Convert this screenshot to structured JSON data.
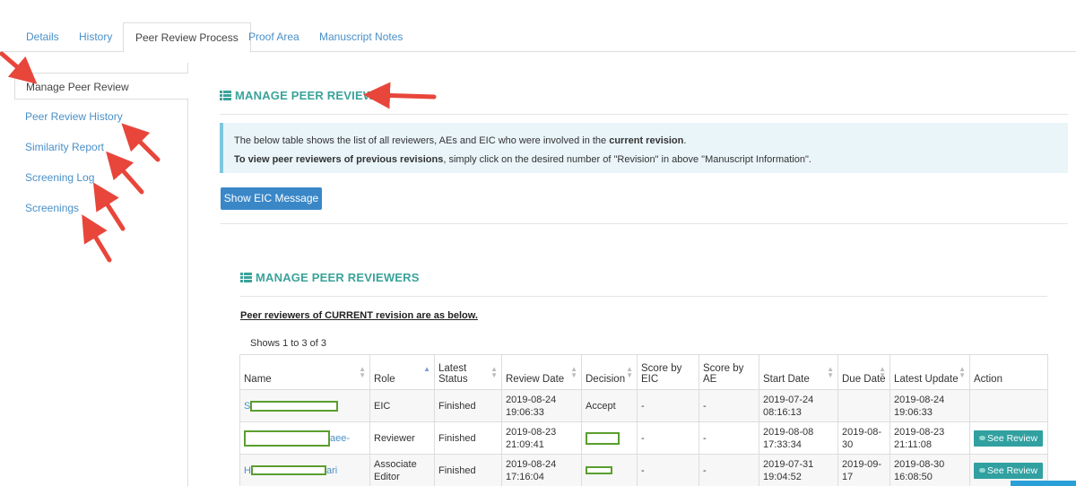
{
  "tabs": [
    "Details",
    "History",
    "Peer Review Process",
    "Proof Area",
    "Manuscript Notes"
  ],
  "active_tab": 2,
  "sidebar": {
    "items": [
      "Manage Peer Review",
      "Peer Review History",
      "Similarity Report",
      "Screening Log",
      "Screenings"
    ]
  },
  "main": {
    "title": "MANAGE PEER REVIEW",
    "info": {
      "line1_prefix": "The below table shows the list of all reviewers, AEs and EIC who were involved in the ",
      "line1_bold": "current revision",
      "line1_suffix": ".",
      "line2_bold": "To view peer reviewers of previous revisions",
      "line2_suffix": ", simply click on the desired number of  \"Revision\" in above \"Manuscript Information\"."
    },
    "show_eic_button": "Show EIC Message"
  },
  "reviewers": {
    "title": "MANAGE PEER REVIEWERS",
    "subtitle": "Peer reviewers of CURRENT revision are as below.",
    "shows": "Shows 1 to 3 of 3",
    "columns": [
      "Name",
      "Role",
      "Latest Status",
      "Review Date",
      "Decision",
      "Score by EIC",
      "Score by AE",
      "Start Date",
      "Due Date",
      "Latest Update",
      "Action"
    ],
    "rows": [
      {
        "name_pre": "S",
        "name_post": "",
        "role": "EIC",
        "status": "Finished",
        "review_date": "2019-08-24 19:06:33",
        "decision": "Accept",
        "score_eic": "-",
        "score_ae": "-",
        "start_date": "2019-07-24 08:16:13",
        "due_date": "",
        "latest_update": "2019-08-24 19:06:33",
        "action": ""
      },
      {
        "name_pre": "",
        "name_post": "aee-",
        "role": "Reviewer",
        "status": "Finished",
        "review_date": "2019-08-23 21:09:41",
        "decision": "",
        "score_eic": "-",
        "score_ae": "-",
        "start_date": "2019-08-08 17:33:34",
        "due_date": "2019-08-30",
        "latest_update": "2019-08-23 21:11:08",
        "action": "See Review"
      },
      {
        "name_pre": "H",
        "name_post": "ari",
        "role": "Associate Editor",
        "status": "Finished",
        "review_date": "2019-08-24 17:16:04",
        "decision": "",
        "score_eic": "-",
        "score_ae": "-",
        "start_date": "2019-07-31 19:04:52",
        "due_date": "2019-09-17",
        "latest_update": "2019-08-30 16:08:50",
        "action": "See Review"
      }
    ]
  },
  "colors": {
    "link": "#4a90c8",
    "heading_teal": "#3aa39a",
    "button_blue": "#3a87c8",
    "see_review": "#31a0a0",
    "annotation_arrow": "#e8463b",
    "redaction_box": "#5a9e2e"
  }
}
